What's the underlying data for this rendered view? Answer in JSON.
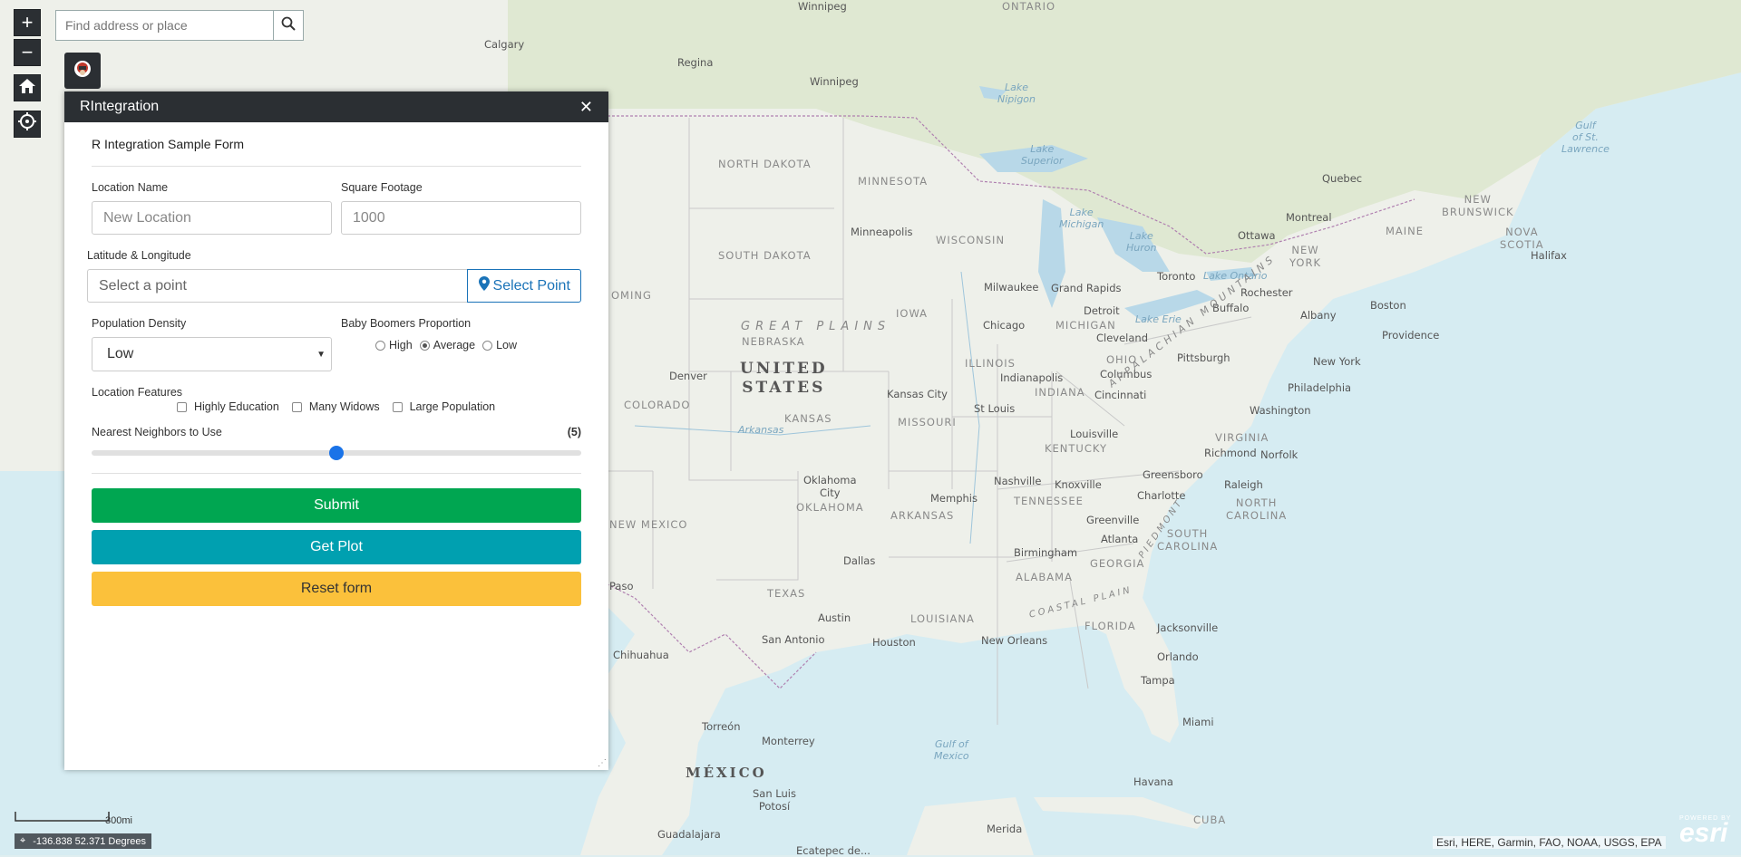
{
  "map": {
    "labels": {
      "ontario": "ONTARIO",
      "winnipeg_top": "Winnipeg",
      "calgary": "Calgary",
      "regina": "Regina",
      "winnipeg": "Winnipeg",
      "lake_nipigon": "Lake\nNipigon",
      "lake_superior": "Lake\nSuperior",
      "north_dakota": "NORTH DAKOTA",
      "minnesota": "MINNESOTA",
      "south_dakota": "SOUTH DAKOTA",
      "minneapolis": "Minneapolis",
      "wisconsin": "WISCONSIN",
      "lake_michigan": "Lake\nMichigan",
      "lake_huron": "Lake\nHuron",
      "ottawa": "Ottawa",
      "montreal": "Montreal",
      "quebec": "Quebec",
      "new_brunswick": "NEW\nBRUNSWICK",
      "maine": "MAINE",
      "nova_scotia": "NOVA\nSCOTIA",
      "halifax": "Halifax",
      "gulf_st_lawrence": "Gulf\nof St.\nLawrence",
      "nebraska": "NEBRASKA",
      "great_plains": "GREAT PLAINS",
      "iowa": "IOWA",
      "milwaukee": "Milwaukee",
      "grand_rapids": "Grand Rapids",
      "detroit": "Detroit",
      "toronto": "Toronto",
      "lake_ontario": "Lake Ontario",
      "rochester": "Rochester",
      "buffalo": "Buffalo",
      "albany": "Albany",
      "new_york_state": "NEW\nYORK",
      "boston": "Boston",
      "providence": "Providence",
      "chicago": "Chicago",
      "michigan": "MICHIGAN",
      "cleveland": "Cleveland",
      "lake_erie": "Lake Erie",
      "pittsburgh": "Pittsburgh",
      "new_york": "New York",
      "philadelphia": "Philadelphia",
      "wyoming": "OMING",
      "denver": "Denver",
      "united_states": "UNITED\nSTATES",
      "colorado": "COLORADO",
      "kansas_city": "Kansas City",
      "illinois": "ILLINOIS",
      "indianapolis": "Indianapolis",
      "indiana": "INDIANA",
      "ohio": "OHIO",
      "columbus": "Columbus",
      "cincinnati": "Cincinnati",
      "washington": "Washington",
      "missouri": "MISSOURI",
      "st_louis": "St Louis",
      "kansas": "KANSAS",
      "arkansas_river": "Arkansas",
      "louisville": "Louisville",
      "kentucky": "KENTUCKY",
      "virginia": "VIRGINIA",
      "richmond": "Richmond",
      "norfolk": "Norfolk",
      "appalachian": "APPALACHIAN MOUNTAINS",
      "oklahoma_city": "Oklahoma\nCity",
      "oklahoma": "OKLAHOMA",
      "memphis": "Memphis",
      "nashville": "Nashville",
      "knoxville": "Knoxville",
      "tennessee": "TENNESSEE",
      "greensboro": "Greensboro",
      "raleigh": "Raleigh",
      "charlotte": "Charlotte",
      "north_carolina": "NORTH\nCAROLINA",
      "arkansas": "ARKANSAS",
      "new_mexico": "NEW MEXICO",
      "greenville": "Greenville",
      "piedmont": "PIEDMONT",
      "atlanta": "Atlanta",
      "south_carolina": "SOUTH\nCAROLINA",
      "dallas": "Dallas",
      "birmingham": "Birmingham",
      "georgia": "GEORGIA",
      "alabama": "ALABAMA",
      "coastal_plain": "COASTAL PLAIN",
      "texas": "TEXAS",
      "el_paso": "Paso",
      "austin": "Austin",
      "louisiana": "LOUISIANA",
      "jacksonville": "Jacksonville",
      "florida": "FLORIDA",
      "san_antonio": "San Antonio",
      "houston": "Houston",
      "new_orleans": "New Orleans",
      "orlando": "Orlando",
      "chihuahua": "Chihuahua",
      "tampa": "Tampa",
      "miami": "Miami",
      "gulf_mexico": "Gulf of\nMexico",
      "torreon": "Torreón",
      "monterrey": "Monterrey",
      "mexico": "MÉXICO",
      "san_luis_potosi": "San Luis\nPotosí",
      "havana": "Havana",
      "cuba": "CUBA",
      "merida": "Merida",
      "guadalajara": "Guadalajara",
      "ecatepec": "Ecatepec de..."
    },
    "zoom_in": "+",
    "zoom_out": "−",
    "scale_label": "300mi",
    "coordinates": "-136.838 52.371 Degrees",
    "attribution": "Esri, HERE, Garmin, FAO, NOAA, USGS, EPA",
    "esri_powered": "POWERED BY",
    "esri_logo": "esri"
  },
  "search": {
    "placeholder": "Find address or place"
  },
  "panel": {
    "title": "RIntegration",
    "form_title": "R Integration Sample Form",
    "location_name_label": "Location Name",
    "location_name_placeholder": "New Location",
    "square_footage_label": "Square Footage",
    "square_footage_placeholder": "1000",
    "latlng_label": "Latitude & Longitude",
    "latlng_placeholder": "Select a point",
    "select_point_label": "Select Point",
    "population_density_label": "Population Density",
    "population_density_value": "Low",
    "baby_boomers_label": "Baby Boomers Proportion",
    "radio_high": "High",
    "radio_average": "Average",
    "radio_low": "Low",
    "radio_selected": "Average",
    "location_features_label": "Location Features",
    "feature_education": "Highly Education",
    "feature_widows": "Many Widows",
    "feature_population": "Large Population",
    "neighbors_label": "Nearest Neighbors to Use",
    "neighbors_value_text": "(5)",
    "neighbors_value": 5,
    "neighbors_min": 0,
    "neighbors_max": 10,
    "submit_label": "Submit",
    "get_plot_label": "Get Plot",
    "reset_label": "Reset form"
  },
  "colors": {
    "submit": "#00a651",
    "get_plot": "#00a0b0",
    "reset": "#fbc13b",
    "header": "#2b2f33",
    "accent": "#1a73b8"
  }
}
